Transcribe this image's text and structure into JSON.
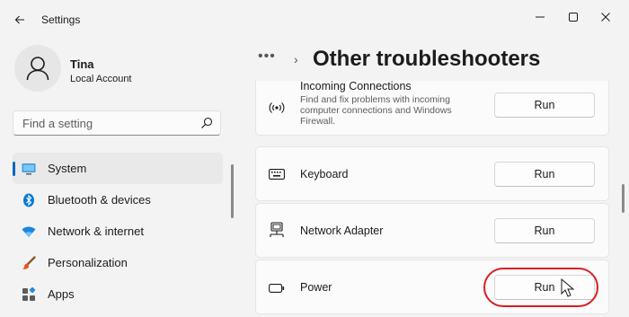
{
  "window": {
    "title": "Settings"
  },
  "user": {
    "name": "Tina",
    "account_type": "Local Account"
  },
  "search": {
    "placeholder": "Find a setting"
  },
  "nav": {
    "items": [
      {
        "label": "System",
        "icon": "monitor-icon",
        "selected": true
      },
      {
        "label": "Bluetooth & devices",
        "icon": "bluetooth-icon"
      },
      {
        "label": "Network & internet",
        "icon": "wifi-icon"
      },
      {
        "label": "Personalization",
        "icon": "paintbrush-icon"
      },
      {
        "label": "Apps",
        "icon": "apps-icon"
      }
    ]
  },
  "breadcrumb": {
    "more": "•••",
    "separator": "›"
  },
  "page": {
    "title": "Other troubleshooters"
  },
  "troubleshooters": [
    {
      "title": "Incoming Connections",
      "description": "Find and fix problems with incoming computer connections and Windows Firewall.",
      "icon": "wireless-signal-icon",
      "button": "Run"
    },
    {
      "title": "Keyboard",
      "icon": "keyboard-icon",
      "button": "Run"
    },
    {
      "title": "Network Adapter",
      "icon": "network-adapter-icon",
      "button": "Run"
    },
    {
      "title": "Power",
      "icon": "battery-icon",
      "button": "Run"
    }
  ],
  "colors": {
    "accent": "#0067c0",
    "highlight": "#d61f26",
    "background": "#f3f3f3",
    "card": "#fbfbfb"
  }
}
